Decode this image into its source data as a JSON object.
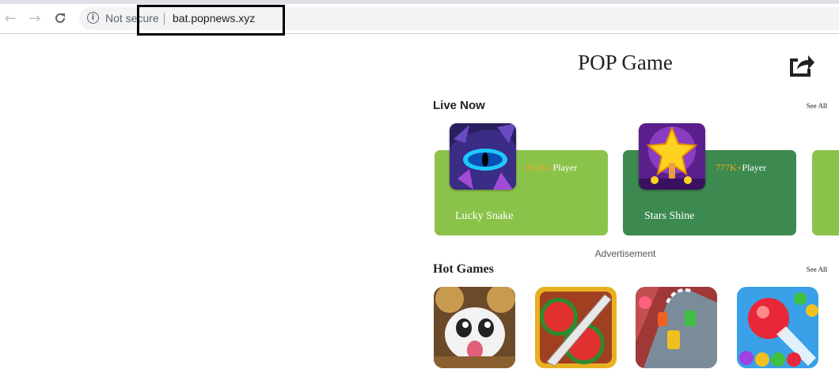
{
  "browser": {
    "security_label": "Not secure",
    "url": "bat.popnews.xyz"
  },
  "page": {
    "title": "POP Game"
  },
  "live_now": {
    "title": "Live Now",
    "see_all": "See All",
    "games": [
      {
        "name": "Lucky Snake",
        "players_count": "813K+",
        "players_suffix": "Player",
        "card_color": "#8bc34a"
      },
      {
        "name": "Stars Shine",
        "players_count": "777K+",
        "players_suffix": "Player",
        "card_color": "#3c8a50"
      }
    ],
    "partial_card_color": "#8bc34a"
  },
  "advertisement": "Advertisement",
  "hot_games": {
    "title": "Hot Games",
    "see_all": "See All",
    "tiles": [
      "poro-game",
      "fruit-slice-game",
      "racing-game",
      "bubble-shooter-game"
    ]
  },
  "colors": {
    "accent_orange": "#f5a524"
  }
}
